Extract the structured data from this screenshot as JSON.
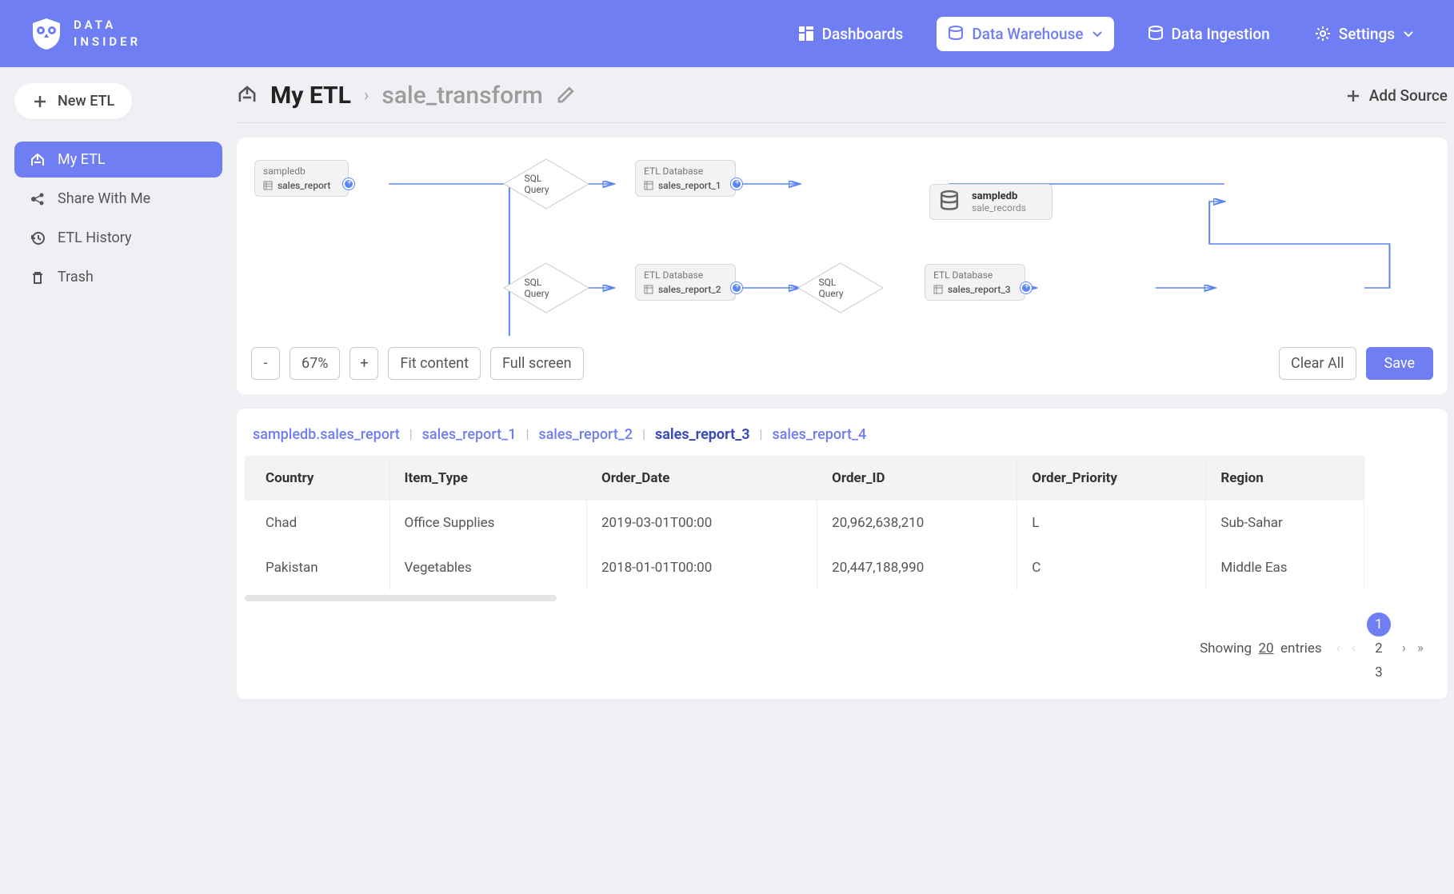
{
  "brand": {
    "line1": "DATA",
    "line2": "INSIDER"
  },
  "nav": {
    "dashboards": "Dashboards",
    "warehouse": "Data Warehouse",
    "ingestion": "Data Ingestion",
    "settings": "Settings"
  },
  "sidebar": {
    "new_etl": "New ETL",
    "items": [
      {
        "label": "My ETL"
      },
      {
        "label": "Share With Me"
      },
      {
        "label": "ETL History"
      },
      {
        "label": "Trash"
      }
    ]
  },
  "breadcrumb": {
    "root": "My ETL",
    "current": "sale_transform",
    "add_source": "Add Source"
  },
  "diagram": {
    "source": {
      "db": "sampledb",
      "table": "sales_report"
    },
    "sql1": "SQL Query",
    "etl1": {
      "db": "ETL Database",
      "table": "sales_report_1"
    },
    "sql2": "SQL Query",
    "etl2": {
      "db": "ETL Database",
      "table": "sales_report_2"
    },
    "sql3": "SQL Query",
    "etl3": {
      "db": "ETL Database",
      "table": "sales_report_3"
    },
    "dest": {
      "db": "sampledb",
      "table": "sale_records"
    }
  },
  "toolbar": {
    "zoom_out": "-",
    "zoom_val": "67%",
    "zoom_in": "+",
    "fit": "Fit content",
    "full": "Full screen",
    "clear": "Clear All",
    "save": "Save"
  },
  "tabs": [
    "sampledb.sales_report",
    "sales_report_1",
    "sales_report_2",
    "sales_report_3",
    "sales_report_4"
  ],
  "active_tab_index": 3,
  "table": {
    "columns": [
      "Country",
      "Item_Type",
      "Order_Date",
      "Order_ID",
      "Order_Priority",
      "Region"
    ],
    "rows": [
      [
        "Chad",
        "Office Supplies",
        "2019-03-01T00:00",
        "20,962,638,210",
        "L",
        "Sub-Sahar"
      ],
      [
        "Pakistan",
        "Vegetables",
        "2018-01-01T00:00",
        "20,447,188,990",
        "C",
        "Middle Eas"
      ]
    ]
  },
  "pager": {
    "showing": "Showing",
    "count": "20",
    "entries": "entries",
    "pages": [
      "1",
      "2",
      "3"
    ],
    "active_page": 0
  }
}
